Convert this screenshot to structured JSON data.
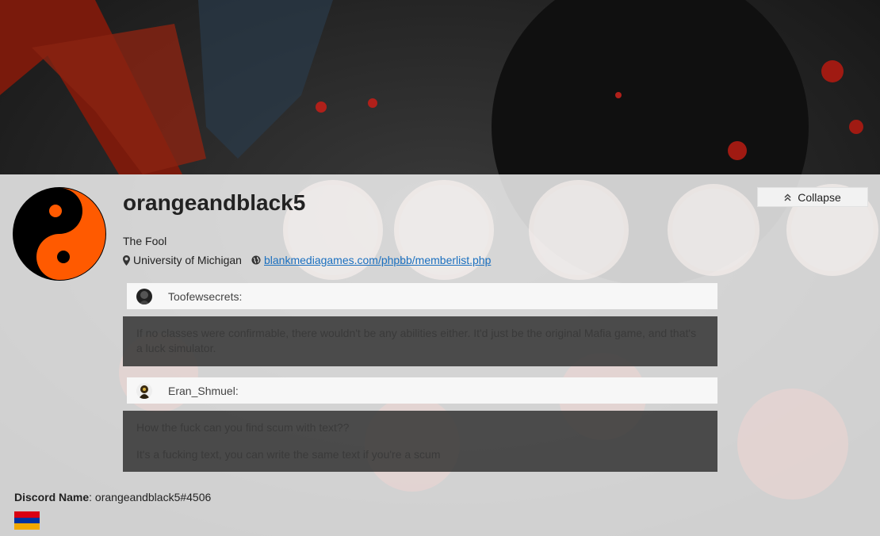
{
  "profile": {
    "username": "orangeandblack5",
    "user_title": "The Fool",
    "location": "University of Michigan",
    "website": "blankmediagames.com/phpbb/memberlist.php",
    "collapse_label": "Collapse"
  },
  "quotes": [
    {
      "author": "Toofewsecrets:",
      "lines": [
        "If no classes were confirmable, there wouldn't be any abilities either. It'd just be the original Mafia game, and that's a luck simulator."
      ]
    },
    {
      "author": "Eran_Shmuel:",
      "lines": [
        "How the fuck can you find scum with text??",
        "It's a fucking text, you can write the same text if you're a scum"
      ]
    }
  ],
  "discord": {
    "label": "Discord Name",
    "value": ": orangeandblack5#4506"
  },
  "flag_colors": [
    "#d90012",
    "#0033a0",
    "#f2a800"
  ],
  "icons": [
    "map-marker-icon",
    "globe-icon",
    "chevron-up-icon"
  ],
  "colors": {
    "link": "#1a6fbf",
    "accent_orange": "#ff5a00"
  }
}
